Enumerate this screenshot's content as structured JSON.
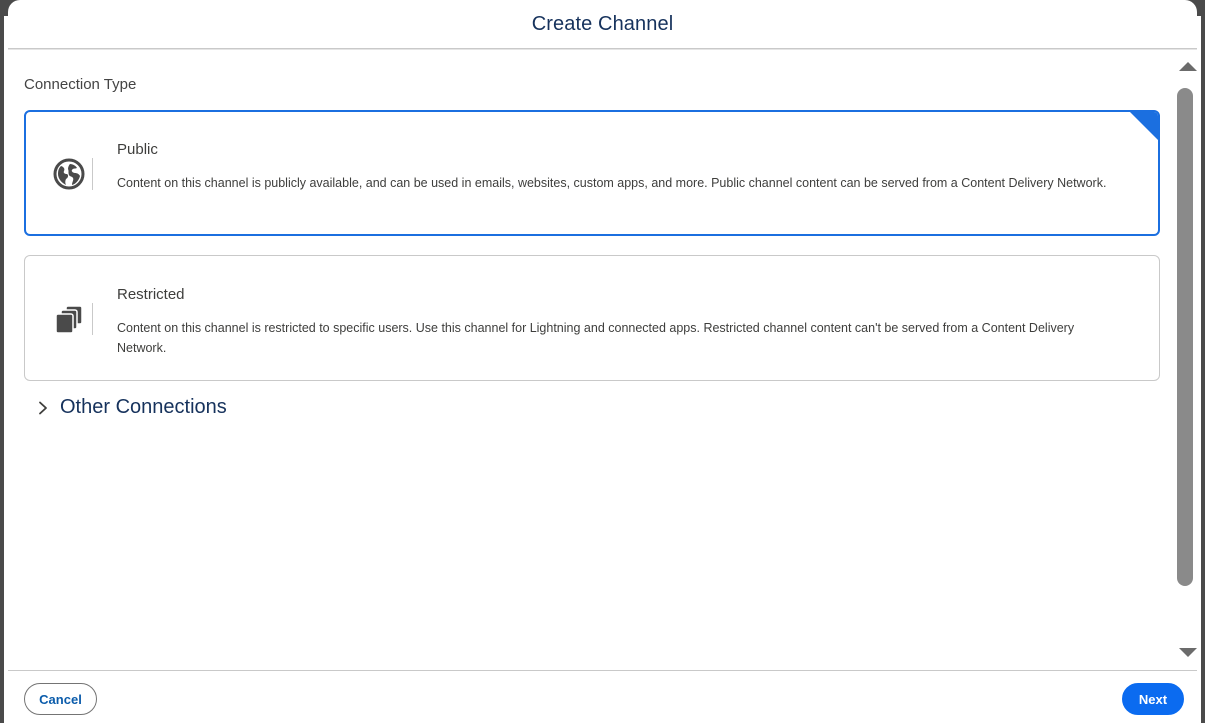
{
  "dialog": {
    "title": "Create Channel"
  },
  "connection_type": {
    "label": "Connection Type",
    "options": [
      {
        "title": "Public",
        "description": "Content on this channel is publicly available, and can be used in emails, websites, custom apps, and more. Public channel content can be served from a Content Delivery Network.",
        "icon": "globe-icon",
        "selected": true
      },
      {
        "title": "Restricted",
        "description": "Content on this channel is restricted to specific users. Use this channel for Lightning and connected apps. Restricted channel content can't be served from a Content Delivery Network.",
        "icon": "stacked-squares-icon",
        "selected": false
      }
    ]
  },
  "other_connections": {
    "label": "Other Connections",
    "icon": "chevron-right-icon"
  },
  "footer": {
    "cancel_label": "Cancel",
    "next_label": "Next"
  },
  "colors": {
    "brand": "#0b6bf0",
    "selected_border": "#1b6fe0",
    "title_text": "#16325c"
  }
}
